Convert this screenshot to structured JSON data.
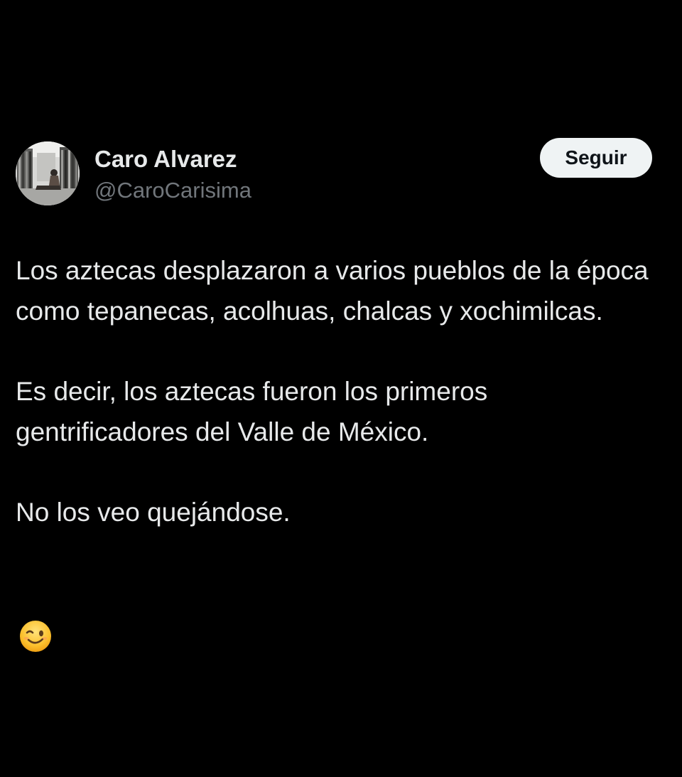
{
  "author": {
    "display_name": "Caro Alvarez",
    "handle": "@CaroCarisima"
  },
  "follow_button": {
    "label": "Seguir"
  },
  "tweet": {
    "paragraphs": [
      "Los aztecas desplazaron a varios pueblos de la época como tepanecas, acolhuas, chalcas y xochimilcas.",
      "Es decir, los aztecas fueron los primeros gentrificadores del Valle de México.",
      "No los veo quejándose."
    ],
    "emoji": "winking-face"
  },
  "colors": {
    "background": "#000000",
    "text_primary": "#e7e9ea",
    "text_secondary": "#71767b",
    "button_bg": "#eff3f4",
    "button_text": "#0f1419"
  }
}
